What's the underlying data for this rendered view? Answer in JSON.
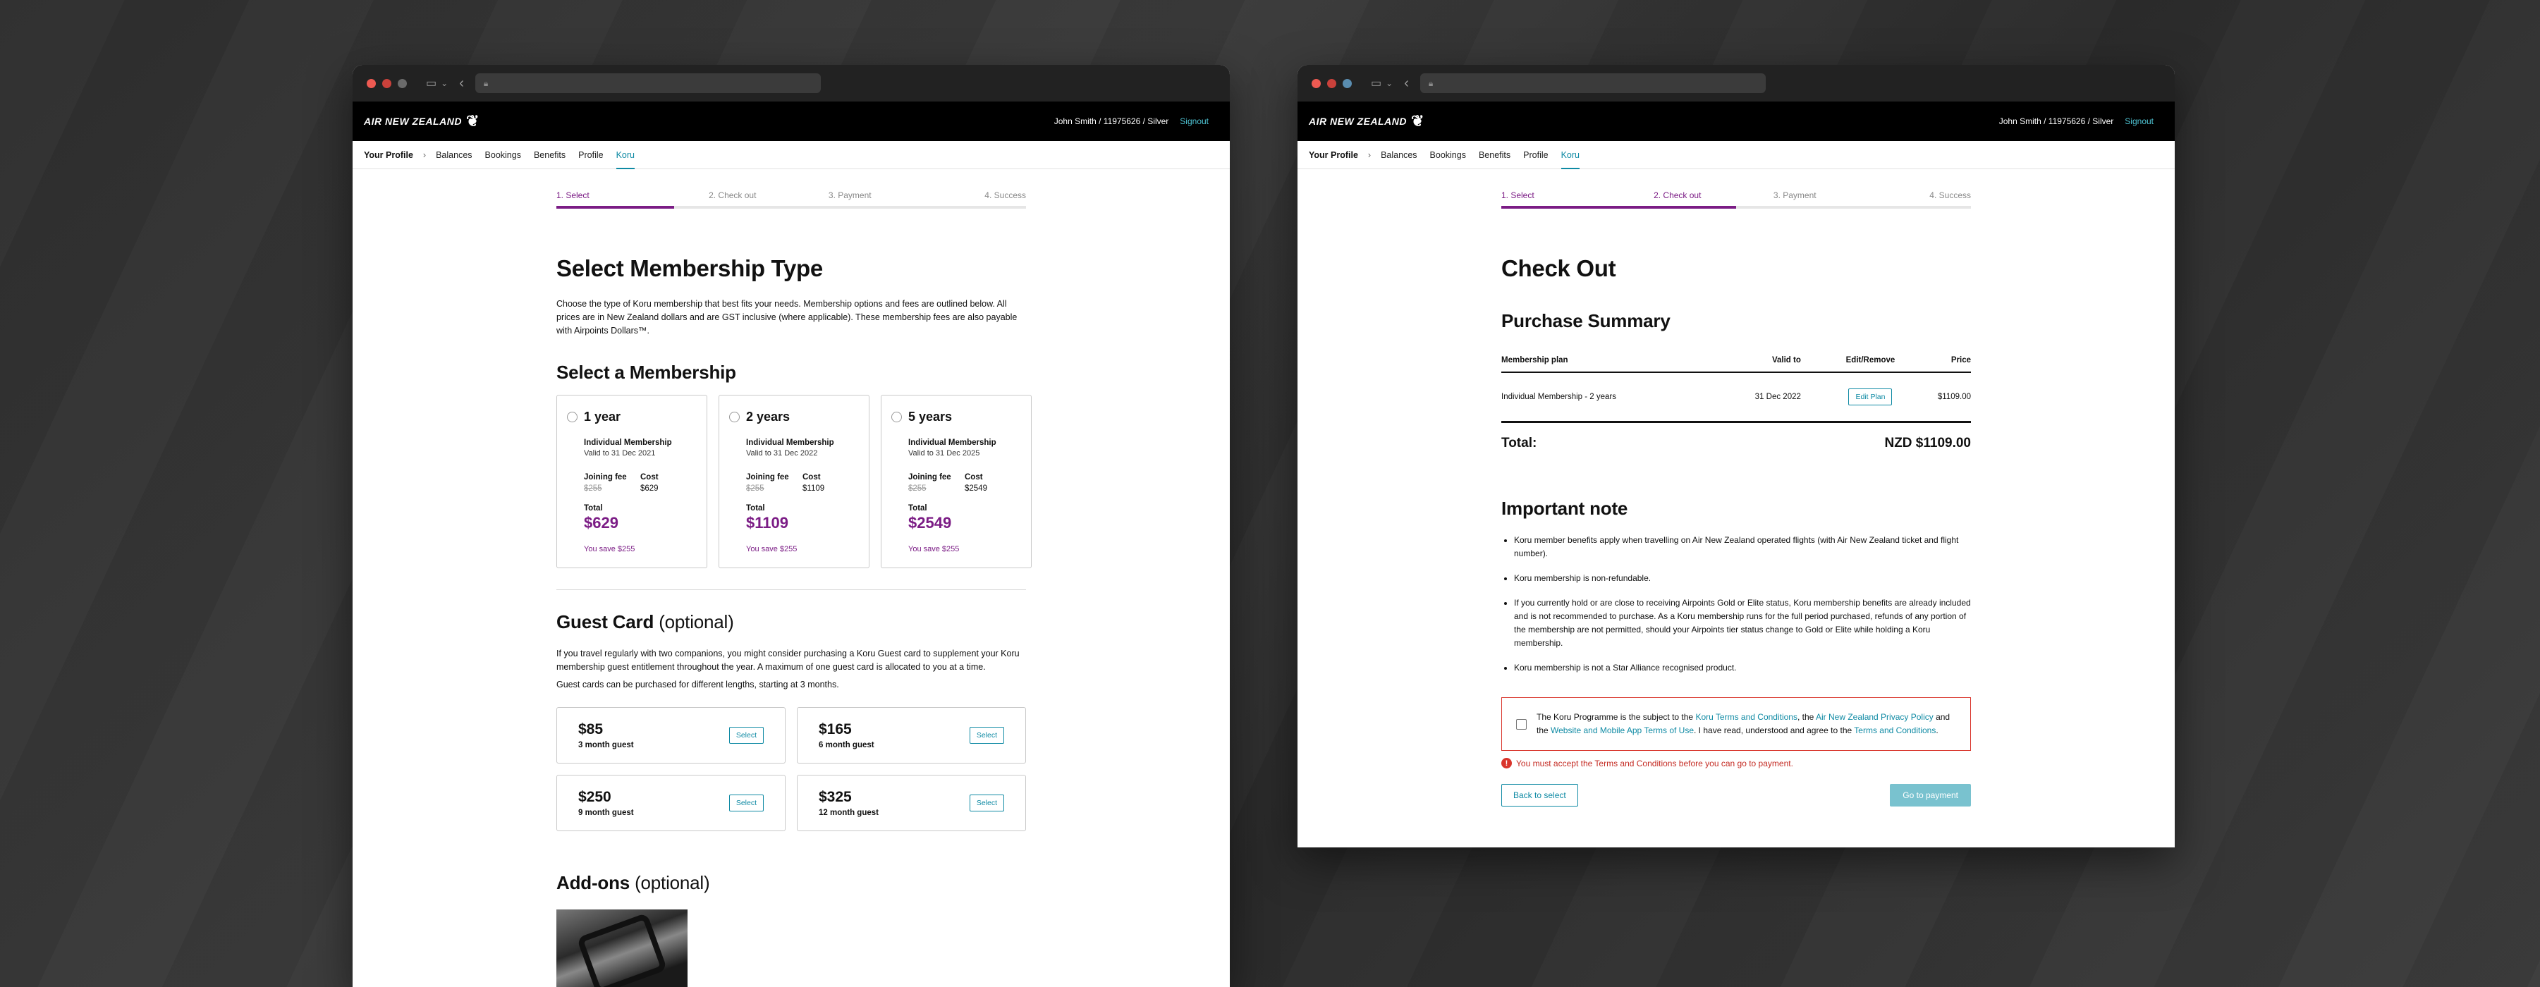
{
  "colors": {
    "accent": "#7b1c85",
    "link": "#0f8aa4",
    "error": "#d9342b",
    "header_bg": "#000000"
  },
  "header": {
    "logo": "AIR NEW ZEALAND",
    "user": "John Smith / 11975626 / Silver",
    "signout": "Signout"
  },
  "nav": {
    "home": "Your Profile",
    "items": [
      "Balances",
      "Bookings",
      "Benefits",
      "Profile",
      "Koru"
    ]
  },
  "steps": [
    "1. Select",
    "2. Check out",
    "3. Payment",
    "4. Success"
  ],
  "select_page": {
    "title": "Select Membership Type",
    "intro": "Choose the type of Koru membership that best fits your needs. Membership options and fees are outlined below. All prices are in New Zealand dollars and are GST inclusive (where applicable). These membership fees are also payable with Airpoints Dollars™.",
    "membership_heading": "Select a Membership",
    "joining_label": "Joining fee",
    "cost_label": "Cost",
    "total_label": "Total",
    "memberships": [
      {
        "term": "1 year",
        "type": "Individual Membership",
        "valid": "Valid to 31 Dec 2021",
        "joining_fee": "$255",
        "cost": "$629",
        "total": "$629",
        "save": "You save $255"
      },
      {
        "term": "2 years",
        "type": "Individual Membership",
        "valid": "Valid to 31 Dec 2022",
        "joining_fee": "$255",
        "cost": "$1109",
        "total": "$1109",
        "save": "You save $255"
      },
      {
        "term": "5 years",
        "type": "Individual Membership",
        "valid": "Valid to 31 Dec 2025",
        "joining_fee": "$255",
        "cost": "$2549",
        "total": "$2549",
        "save": "You save $255"
      }
    ],
    "guest_heading": "Guest Card",
    "guest_optional": "(optional)",
    "guest_intro": "If you travel regularly with two companions, you might consider purchasing a Koru Guest card to supplement your Koru membership guest entitlement throughout the year. A maximum of one guest card is allocated to you at a time.",
    "guest_note": "Guest cards can be purchased for different lengths, starting at 3 months.",
    "select_label": "Select",
    "guest_cards": [
      {
        "price": "$85",
        "length": "3 month guest"
      },
      {
        "price": "$165",
        "length": "6 month guest"
      },
      {
        "price": "$250",
        "length": "9 month guest"
      },
      {
        "price": "$325",
        "length": "12 month guest"
      }
    ],
    "addons_heading": "Add-ons",
    "addons_optional": "(optional)"
  },
  "checkout_page": {
    "title": "Check Out",
    "summary_heading": "Purchase Summary",
    "table_headers": [
      "Membership plan",
      "Valid to",
      "Edit/Remove",
      "Price"
    ],
    "row": {
      "plan": "Individual Membership - 2 years",
      "valid": "31 Dec 2022",
      "edit": "Edit Plan",
      "price": "$1109.00"
    },
    "total_label": "Total:",
    "total_value": "NZD $1109.00",
    "note_heading": "Important note",
    "notes": [
      "Koru member benefits apply when travelling on Air New Zealand operated flights (with Air New Zealand ticket and flight number).",
      "Koru membership is non-refundable.",
      "If you currently hold or are close to receiving Airpoints Gold or Elite status, Koru membership benefits are already included and is not recommended to purchase. As a Koru membership runs for the full period purchased, refunds of any portion of the membership are not permitted, should your Airpoints tier status change to Gold or Elite while holding a Koru membership.",
      "Koru membership is not a Star Alliance recognised product."
    ],
    "terms": {
      "t1": "The Koru Programme is the subject to the ",
      "l1": "Koru Terms and Conditions",
      "t2": ", the ",
      "l2": "Air New Zealand Privacy Policy",
      "t3": " and the ",
      "l3": "Website and Mobile App Terms of Use",
      "t4": ". I have read, understood and agree to the ",
      "l4": "Terms and Conditions",
      "t5": "."
    },
    "error": "You must accept the Terms and Conditions before you can go to payment.",
    "back_button": "Back to select",
    "payment_button": "Go to payment"
  }
}
